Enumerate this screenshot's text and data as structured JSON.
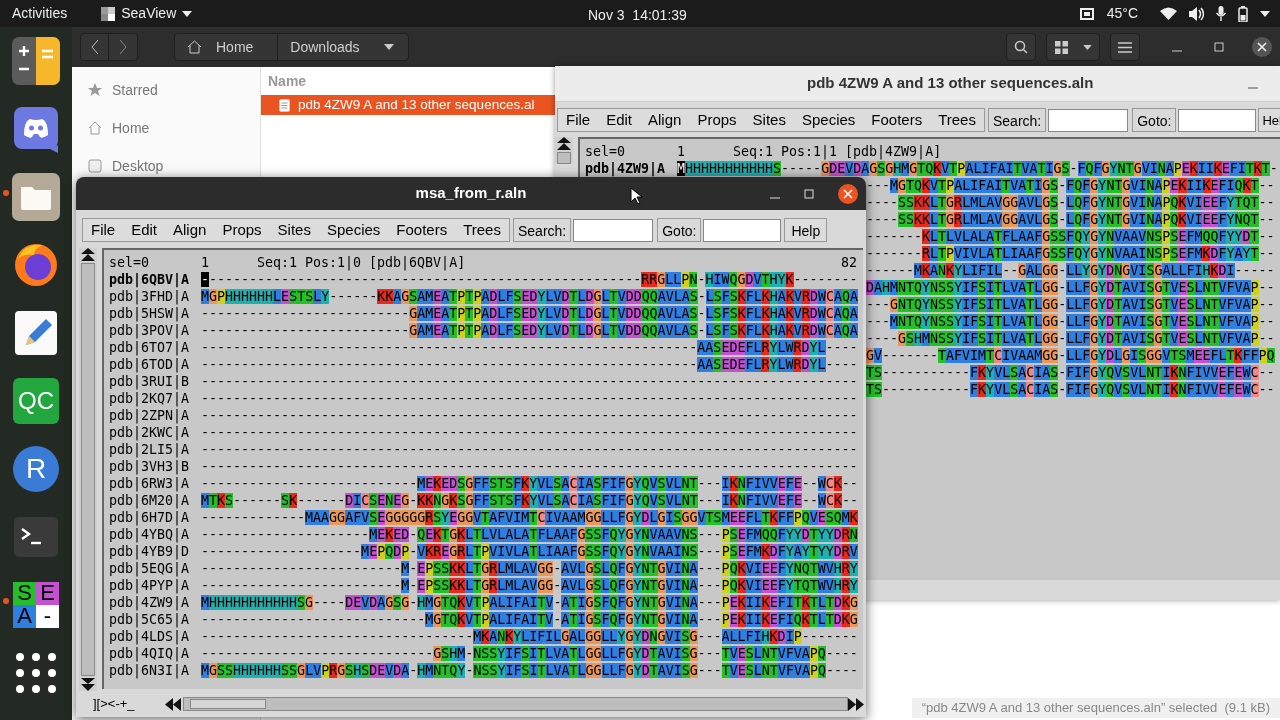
{
  "top_bar": {
    "activities": "Activities",
    "app_name": "SeaView",
    "clock": "Nov 3  14:01:39",
    "temperature": "45°C"
  },
  "dock": [
    {
      "kind": "calculator",
      "running": false
    },
    {
      "kind": "chat",
      "running": false
    },
    {
      "kind": "folder",
      "running": true
    },
    {
      "kind": "browser",
      "running": false
    },
    {
      "kind": "editor",
      "running": false
    },
    {
      "kind": "tile",
      "label": "QC",
      "running": false
    },
    {
      "kind": "circle",
      "label": "R",
      "running": false
    },
    {
      "kind": "terminal",
      "running": false
    },
    {
      "kind": "seaview",
      "letters": [
        "S",
        "E",
        "A",
        "-"
      ],
      "running": true
    },
    {
      "kind": "apps",
      "running": false
    }
  ],
  "file_manager": {
    "path": [
      "Home",
      "Downloads"
    ],
    "sidebar": [
      {
        "kind": "starred",
        "label": "Starred"
      },
      {
        "kind": "home",
        "label": "Home"
      },
      {
        "kind": "desktop",
        "label": "Desktop"
      }
    ],
    "column": "Name",
    "files": [
      {
        "name": "pdb 4ZW9 A and 13 other sequences.al",
        "selected": true
      }
    ],
    "status": "“pdb 4ZW9 A and 13 other sequences.aln” selected  (9.1 kB)"
  },
  "back_window": {
    "title": "pdb 4ZW9 A and 13 other sequences.aln",
    "menu": [
      "File",
      "Edit",
      "Align",
      "Props",
      "Sites",
      "Species",
      "Footers",
      "Trees"
    ],
    "search_label": "Search:",
    "goto_label": "Goto:",
    "help": "Hel",
    "header": {
      "selection": "sel=0",
      "start": "1",
      "info": "Seq:1 Pos:1|1 [pdb|4ZW9|A]"
    },
    "first_row": {
      "name": "pdb|4ZW9|A",
      "sequence": "MHHHHHHHHHHHS-----GDEVDAGSGHMGTQKVTPALIFAITVATIGS-FQFGYNTGVINAPEKIIKEFITKT-",
      "current": true,
      "cursor": true
    },
    "partial_rows": [
      "---MGTQKVTPALIFAITVATIGS-FQFGYNTGVINAPEKIIKEFIQKT--",
      "----SSKKLTGRLMLAVGGAVLGS-LQFGYNTGVINAPQKVIEEFYTQT--",
      "----SSKKLTGRLMLAVGGAVLGS-LQFGYNTGVINAPQKVIEEFYNQT--",
      "-------KLTLVLALATFLAAFGSSFQYGYNVAAVNSPSEFMQQFYYDT--",
      "-------RLTPVIVLATLIAAFGSSFQYGYNVAAINSPSEFMKDFYAYT--",
      "------MKANKYLIFIL--GALGG-LLYGYDNGVISGALLFIHKDI-----",
      "DAHMNTQYNSSYIFSITLVATLGG-LLFGYDTAVISGTVESLNTVFVAP--",
      "---GNTQYNSSYIFSITLVATLGG-LLFGYDTAVISGTVESLNTVFVAP--",
      "---MNTQYNSSYIFSITLVATLGG-LLFGYDTAVISGTVESLNTVFVAP--",
      "----GSHMNSSYIFSITLVATLGG-LLFGYDTAVISGTVESLNTVFVAP--",
      "GV-------TAFVIMTCIVAAMGG-LLFGYDLGISGGVTSMEEFLTKFFPQ",
      "TS-----------FKYVLSACIAS-FIFGYQVSVLNTIKNFIVVEFEWC--",
      "TS-----------FKYVLSACIAS-FIFGYQVSVLNTIKNFIVVEFEWC--"
    ]
  },
  "front_window": {
    "title": "msa_from_r.aln",
    "menu": [
      "File",
      "Edit",
      "Align",
      "Props",
      "Sites",
      "Species",
      "Footers",
      "Trees"
    ],
    "search_label": "Search:",
    "goto_label": "Goto:",
    "help": "Help",
    "header": {
      "selection": "sel=0",
      "start": "1",
      "info": "Seq:1 Pos:1|0 [pdb|6QBV|A]",
      "end": "82"
    },
    "rows": [
      {
        "name": "pdb|6QBV|A",
        "current": true,
        "cursor": true,
        "sequence": "-------------------------------------------------------RRGLLPN-HIWQGDVTHYK--------"
      },
      {
        "name": "pdb|3FHD|A",
        "current": false,
        "cursor": false,
        "sequence": "MGPHHHHHHLESTSLY------KKAGSAMEATPTPADLFSEDYLVDTLDGLTVDDQQAVLAS-LSFSKFLKHAKVRDWCAQA"
      },
      {
        "name": "pdb|5HSW|A",
        "current": false,
        "cursor": false,
        "sequence": "--------------------------GAMEATPTPADLFSEDYLVDTLDGLTVDDQQAVLAS-LSFSKFLKHAKVRDWCAQA"
      },
      {
        "name": "pdb|3POV|A",
        "current": false,
        "cursor": false,
        "sequence": "--------------------------GAMEATPTPADLFSEDYLVDTLDGLTVDDQQAVLAS-LSFSKFLKHAKVRDWCAQA"
      },
      {
        "name": "pdb|6TO7|A",
        "current": false,
        "cursor": false,
        "sequence": "--------------------------------------------------------------AASEDEFLRYLWRDYL----"
      },
      {
        "name": "pdb|6TOD|A",
        "current": false,
        "cursor": false,
        "sequence": "--------------------------------------------------------------AASEDEFLRYLWRDYL----"
      },
      {
        "name": "pdb|3RUI|B",
        "current": false,
        "cursor": false,
        "sequence": "----------------------------------------------------------------------------------"
      },
      {
        "name": "pdb|2KQ7|A",
        "current": false,
        "cursor": false,
        "sequence": "----------------------------------------------------------------------------------"
      },
      {
        "name": "pdb|2ZPN|A",
        "current": false,
        "cursor": false,
        "sequence": "----------------------------------------------------------------------------------"
      },
      {
        "name": "pdb|2KWC|A",
        "current": false,
        "cursor": false,
        "sequence": "----------------------------------------------------------------------------------"
      },
      {
        "name": "pdb|2LI5|A",
        "current": false,
        "cursor": false,
        "sequence": "----------------------------------------------------------------------------------"
      },
      {
        "name": "pdb|3VH3|B",
        "current": false,
        "cursor": false,
        "sequence": "----------------------------------------------------------------------------------"
      },
      {
        "name": "pdb|6RW3|A",
        "current": false,
        "cursor": false,
        "sequence": "---------------------------MEKEDSGFFSTSFKYVLSACIASFIFGYQVSVLNT---IKNFIVVEFE--WCK--"
      },
      {
        "name": "pdb|6M20|A",
        "current": false,
        "cursor": false,
        "sequence": "MTKS------SK------DICSENEG-KKNGKSGFFSTSFKYVLSACIASFIFGYQVSVLNT---IKNFIVVEFE--WCK--"
      },
      {
        "name": "pdb|6H7D|A",
        "current": false,
        "cursor": false,
        "sequence": "-------------MAAGGAFVSEGGGGGRSYEGGVTAFVIMTCIVAAMGGLLFGYDLGISGGVTSMEEFLTKFFPQVESQMK"
      },
      {
        "name": "pdb|4YBQ|A",
        "current": false,
        "cursor": false,
        "sequence": "---------------------MEKED-QEKTGKLTLVLALATFLAAFGSSFQYGYNVAAVNS---PSEFMQQFYYDTYYDRN"
      },
      {
        "name": "pdb|4YB9|D",
        "current": false,
        "cursor": false,
        "sequence": "--------------------MEPQDP-VKREGRLTPVIVLATLIAAFGSSFQYGYNVAAINS---PSEFMKDFYAYTYYDRV"
      },
      {
        "name": "pdb|5EQG|A",
        "current": false,
        "cursor": false,
        "sequence": "-------------------------M-EPSSKKLTGRLMLAVGG-AVLGSLQFGYNTGVINA---PQKVIEEFYNQTWVHRY"
      },
      {
        "name": "pdb|4PYP|A",
        "current": false,
        "cursor": false,
        "sequence": "-------------------------M-EPSSKKLTGRLMLAVGG-AVLGSLQFGYNTGVINA---PQKVIEEFYTQTWVHRY"
      },
      {
        "name": "pdb|4ZW9|A",
        "current": false,
        "cursor": false,
        "sequence": "MHHHHHHHHHHHSG----DEVDAGSG-HMGTQKVTPALIFAITV-ATIGSFQFGYNTGVINA---PEKIIKEFITKTLTDKG"
      },
      {
        "name": "pdb|5C65|A",
        "current": false,
        "cursor": false,
        "sequence": "----------------------------MGTQKVTPALIFAITV-ATIGSFQFGYNTGVINA---PEKIIKEFIQKTLTDKG"
      },
      {
        "name": "pdb|4LDS|A",
        "current": false,
        "cursor": false,
        "sequence": "----------------------------------MKANKYLIFILGALGGLLYGYDNGVISG---ALLFIHKDIP-------"
      },
      {
        "name": "pdb|4QIQ|A",
        "current": false,
        "cursor": false,
        "sequence": "-----------------------------GSHM-NSSYIFSITLVATLGGLLFGYDTAVISG---TVESLNTVFVAPQ----"
      },
      {
        "name": "pdb|6N3I|A",
        "current": false,
        "cursor": false,
        "sequence": "MGSSHHHHHHSSGLVPRGSHSDEVDA-HMNTQY-NSSYIFSITLVATLGGLLFGYDTAVISG---TVESLNTVFVAPQ----"
      }
    ],
    "footer_controls": "][><-+_"
  }
}
